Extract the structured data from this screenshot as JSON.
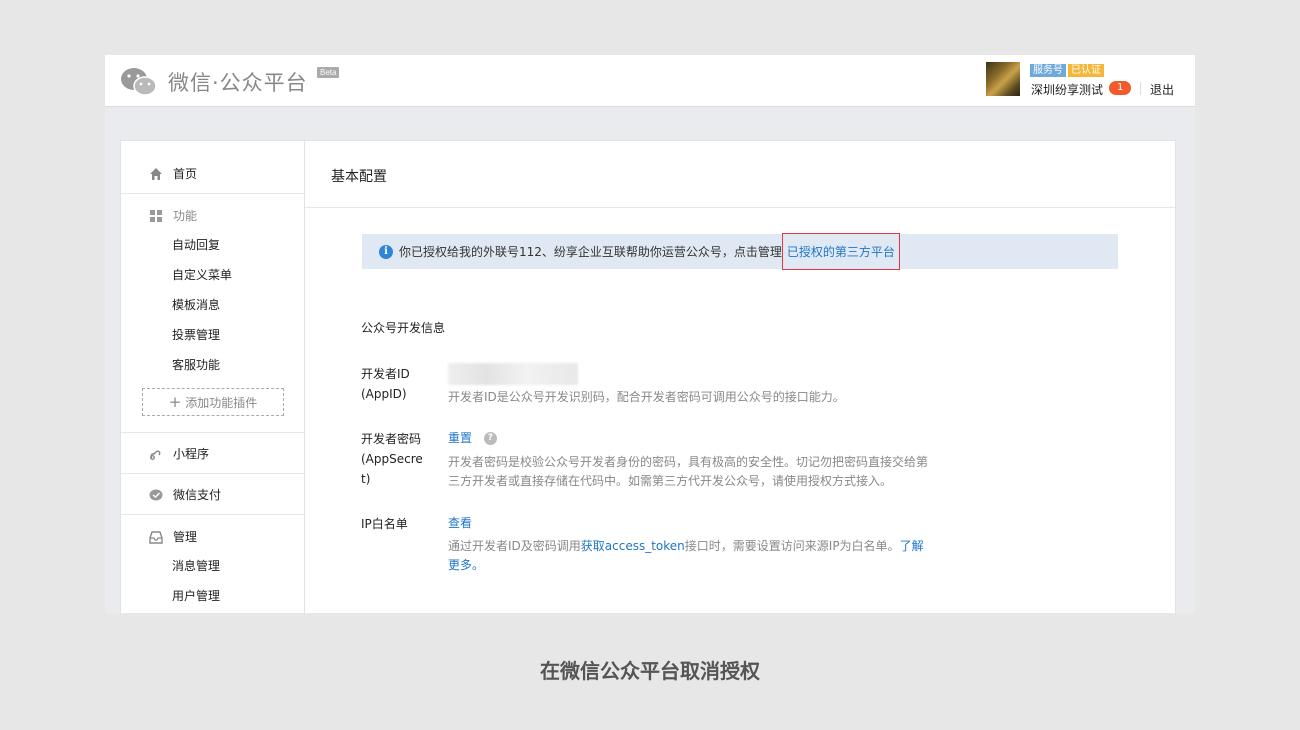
{
  "header": {
    "logo_text": "微信·公众平台",
    "beta_label": "Beta",
    "service_badge": "服务号",
    "verified_badge": "已认证",
    "account_name": "深圳纷享测试",
    "notification_count": "1",
    "logout_label": "退出"
  },
  "sidebar": {
    "home": "首页",
    "features_group": "功能",
    "feature_items": [
      "自动回复",
      "自定义菜单",
      "模板消息",
      "投票管理",
      "客服功能"
    ],
    "add_plugin": "添加功能插件",
    "mini_program": "小程序",
    "wechat_pay": "微信支付",
    "manage_group": "管理",
    "manage_items": [
      "消息管理",
      "用户管理"
    ]
  },
  "main": {
    "title": "基本配置",
    "info_text": "你已授权给我的外联号112、纷享企业互联帮助你运营公众号，点击管理",
    "info_link": "已授权的第三方平台",
    "section_title": "公众号开发信息",
    "fields": {
      "appid": {
        "label_line1": "开发者ID",
        "label_line2": "(AppID)",
        "help": "开发者ID是公众号开发识别码，配合开发者密码可调用公众号的接口能力。"
      },
      "secret": {
        "label_line1": "开发者密码",
        "label_line2": "(AppSecre",
        "label_line3": "t)",
        "action": "重置",
        "help_line1": "开发者密码是校验公众号开发者身份的密码，具有极高的安全性。切记勿把密码直接交给第",
        "help_line2": "三方开发者或直接存储在代码中。如需第三方代开发公众号，请使用授权方式接入。"
      },
      "ip_whitelist": {
        "label": "IP白名单",
        "action": "查看",
        "help_prefix": "通过开发者ID及密码调用",
        "help_link": "获取access_token",
        "help_middle": "接口时，需要设置访问来源IP为白名单。",
        "help_link2_a": "了解",
        "help_link2_b": "更多。"
      }
    }
  },
  "caption": "在微信公众平台取消授权"
}
